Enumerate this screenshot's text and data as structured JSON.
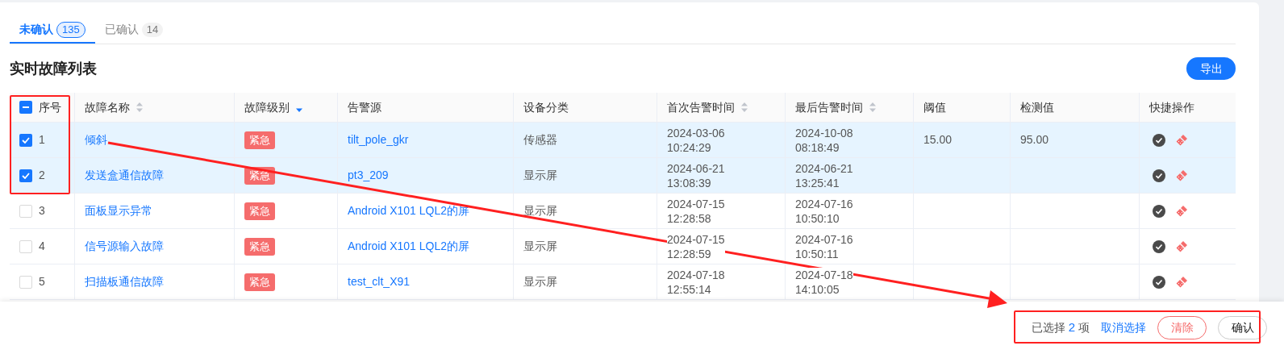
{
  "tabs": [
    {
      "label": "未确认",
      "count": "135",
      "selected": true
    },
    {
      "label": "已确认",
      "count": "14",
      "selected": false
    }
  ],
  "title": "实时故障列表",
  "export_button": "导出",
  "table": {
    "select_all": {
      "indeterminate": true
    },
    "columns": [
      {
        "label": "序号",
        "sortable": false
      },
      {
        "label": "故障名称",
        "sortable": true,
        "sorted_desc": false
      },
      {
        "label": "故障级别",
        "sortable": true,
        "sorted_desc": true
      },
      {
        "label": "告警源",
        "sortable": false
      },
      {
        "label": "设备分类",
        "sortable": false
      },
      {
        "label": "首次告警时间",
        "sortable": true,
        "sorted_desc": false
      },
      {
        "label": "最后告警时间",
        "sortable": true,
        "sorted_desc": false
      },
      {
        "label": "阈值",
        "sortable": false
      },
      {
        "label": "检测值",
        "sortable": false
      },
      {
        "label": "快捷操作",
        "sortable": false
      }
    ],
    "rows": [
      {
        "index": "1",
        "checked": true,
        "name": "倾斜",
        "level": "紧急",
        "source": "tilt_pole_gkr",
        "category": "传感器",
        "first_time": [
          "2024-03-06",
          "10:24:29"
        ],
        "last_time": [
          "2024-10-08",
          "08:18:49"
        ],
        "threshold": "15.00",
        "measured": "95.00"
      },
      {
        "index": "2",
        "checked": true,
        "name": "发送盒通信故障",
        "level": "紧急",
        "source": "pt3_209",
        "category": "显示屏",
        "first_time": [
          "2024-06-21",
          "13:08:39"
        ],
        "last_time": [
          "2024-06-21",
          "13:25:41"
        ]
      },
      {
        "index": "3",
        "checked": false,
        "name": "面板显示异常",
        "level": "紧急",
        "source": "Android X101 LQL2的屏",
        "category": "显示屏",
        "first_time": [
          "2024-07-15",
          "12:28:58"
        ],
        "last_time": [
          "2024-07-16",
          "10:50:10"
        ]
      },
      {
        "index": "4",
        "checked": false,
        "name": "信号源输入故障",
        "level": "紧急",
        "source": "Android X101 LQL2的屏",
        "category": "显示屏",
        "first_time": [
          "2024-07-15",
          "12:28:59"
        ],
        "last_time": [
          "2024-07-16",
          "10:50:11"
        ]
      },
      {
        "index": "5",
        "checked": false,
        "name": "扫描板通信故障",
        "level": "紧急",
        "source": "test_clt_X91",
        "category": "显示屏",
        "first_time": [
          "2024-07-18",
          "12:55:14"
        ],
        "last_time": [
          "2024-07-18",
          "14:10:05"
        ]
      }
    ]
  },
  "footer": {
    "selected_prefix": "已选择",
    "selected_count": "2",
    "selected_suffix": "项",
    "deselect_link": "取消选择",
    "clear_button": "清除",
    "confirm_button": "确认"
  }
}
